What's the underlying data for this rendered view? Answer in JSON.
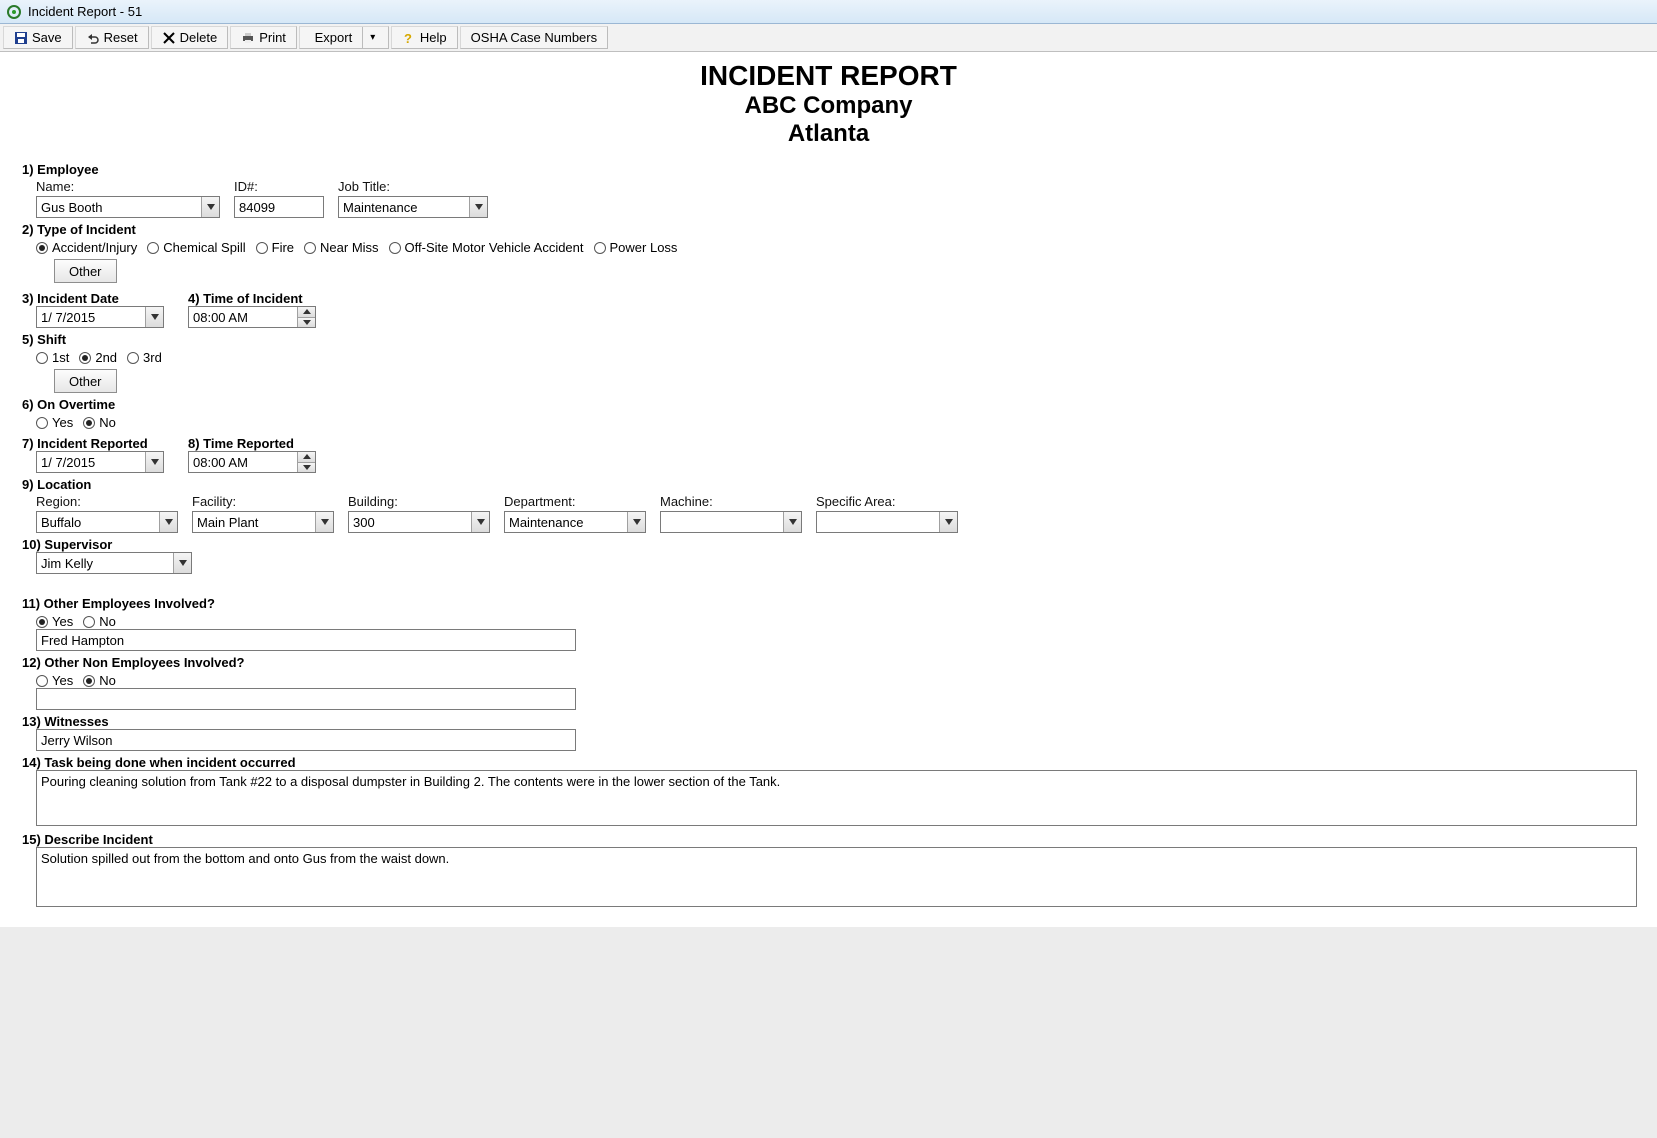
{
  "window": {
    "title": "Incident Report - 51"
  },
  "toolbar": {
    "save": "Save",
    "reset": "Reset",
    "delete": "Delete",
    "print": "Print",
    "export": "Export",
    "help": "Help",
    "osha": "OSHA Case Numbers"
  },
  "header": {
    "line1": "INCIDENT REPORT",
    "line2": "ABC Company",
    "line3": "Atlanta"
  },
  "sections": {
    "employee": "1) Employee",
    "incident_type": "2) Type of Incident",
    "incident_date": "3) Incident Date",
    "incident_time": "4) Time of Incident",
    "shift": "5) Shift",
    "overtime": "6) On Overtime",
    "incident_reported": "7) Incident Reported",
    "time_reported": "8) Time Reported",
    "location": "9) Location",
    "supervisor": "10) Supervisor",
    "other_emp": "11) Other Employees Involved?",
    "other_non": "12) Other Non Employees Involved?",
    "witnesses": "13) Witnesses",
    "task": "14) Task being done when incident occurred",
    "describe": "15) Describe Incident"
  },
  "employee": {
    "name_label": "Name:",
    "name": "Gus Booth",
    "id_label": "ID#:",
    "id": "84099",
    "jobtitle_label": "Job Title:",
    "jobtitle": "Maintenance"
  },
  "incident_type": {
    "options": {
      "accident": "Accident/Injury",
      "chemical": "Chemical Spill",
      "fire": "Fire",
      "nearmiss": "Near Miss",
      "offsite": "Off-Site Motor Vehicle Accident",
      "powerloss": "Power Loss"
    },
    "selected": "accident",
    "other_btn": "Other"
  },
  "incident_date": "1/ 7/2015",
  "incident_time": "08:00 AM",
  "shift": {
    "options": {
      "s1": "1st",
      "s2": "2nd",
      "s3": "3rd"
    },
    "selected": "s2",
    "other_btn": "Other"
  },
  "overtime": {
    "options": {
      "yes": "Yes",
      "no": "No"
    },
    "selected": "no"
  },
  "reported_date": "1/ 7/2015",
  "reported_time": "08:00 AM",
  "location": {
    "region_label": "Region:",
    "region": "Buffalo",
    "facility_label": "Facility:",
    "facility": "Main Plant",
    "building_label": "Building:",
    "building": "300",
    "department_label": "Department:",
    "department": "Maintenance",
    "machine_label": "Machine:",
    "machine": "",
    "area_label": "Specific Area:",
    "area": ""
  },
  "supervisor": "Jim Kelly",
  "other_emp": {
    "options": {
      "yes": "Yes",
      "no": "No"
    },
    "selected": "yes",
    "value": "Fred Hampton"
  },
  "other_non": {
    "options": {
      "yes": "Yes",
      "no": "No"
    },
    "selected": "no",
    "value": ""
  },
  "witnesses": "Jerry Wilson",
  "task_text": "Pouring cleaning solution from Tank #22 to a disposal dumpster in Building 2. The contents were in the lower section of the Tank.",
  "describe_text": "Solution spilled out from the bottom and onto Gus from the waist down."
}
